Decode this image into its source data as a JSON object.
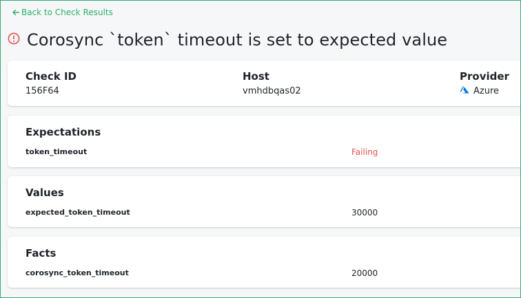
{
  "back_link": {
    "label": "Back to Check Results"
  },
  "page": {
    "title": "Corosync `token` timeout is set to expected value",
    "status_icon": "critical-exclamation-icon",
    "status_color": "#e0534f"
  },
  "info": {
    "check_id": {
      "label": "Check ID",
      "value": "156F64"
    },
    "host": {
      "label": "Host",
      "value": "vmhdbqas02"
    },
    "provider": {
      "label": "Provider",
      "value": "Azure",
      "icon": "azure-icon"
    }
  },
  "expectations": {
    "title": "Expectations",
    "rows": [
      {
        "name": "token_timeout",
        "result": "Failing"
      }
    ]
  },
  "values": {
    "title": "Values",
    "rows": [
      {
        "name": "expected_token_timeout",
        "value": "30000"
      }
    ]
  },
  "facts": {
    "title": "Facts",
    "rows": [
      {
        "name": "corosync_token_timeout",
        "value": "20000"
      }
    ]
  },
  "colors": {
    "accent": "#2fae6d",
    "failing": "#e0534f",
    "azure": "#0078d4"
  }
}
